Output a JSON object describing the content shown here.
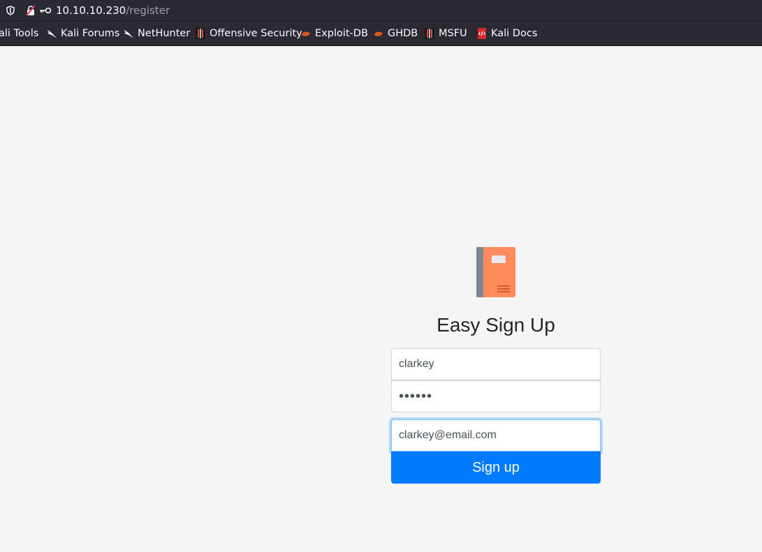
{
  "browser": {
    "url_host": "10.10.10.230",
    "url_path": "/register",
    "bookmarks": [
      {
        "label": "ali Tools",
        "icon": "none"
      },
      {
        "label": "Kali Forums",
        "icon": "kali-dragon-icon"
      },
      {
        "label": "NetHunter",
        "icon": "kali-dragon-icon"
      },
      {
        "label": "Offensive Security",
        "icon": "offsec-icon"
      },
      {
        "label": "Exploit-DB",
        "icon": "exploit-db-icon"
      },
      {
        "label": "GHDB",
        "icon": "exploit-db-icon"
      },
      {
        "label": "MSFU",
        "icon": "offsec-icon"
      },
      {
        "label": "Kali Docs",
        "icon": "kali-docs-icon"
      }
    ]
  },
  "form": {
    "logo_icon": "notebook-icon",
    "title": "Easy Sign Up",
    "username_value": "clarkey",
    "password_value": "••••••",
    "email_value": "clarkey@email.com",
    "submit_label": "Sign up"
  },
  "colors": {
    "accent": "#007bff",
    "page_background": "#f5f5f5",
    "browser_chrome": "#2b2a33",
    "logo_cover": "#ff8a5b"
  }
}
